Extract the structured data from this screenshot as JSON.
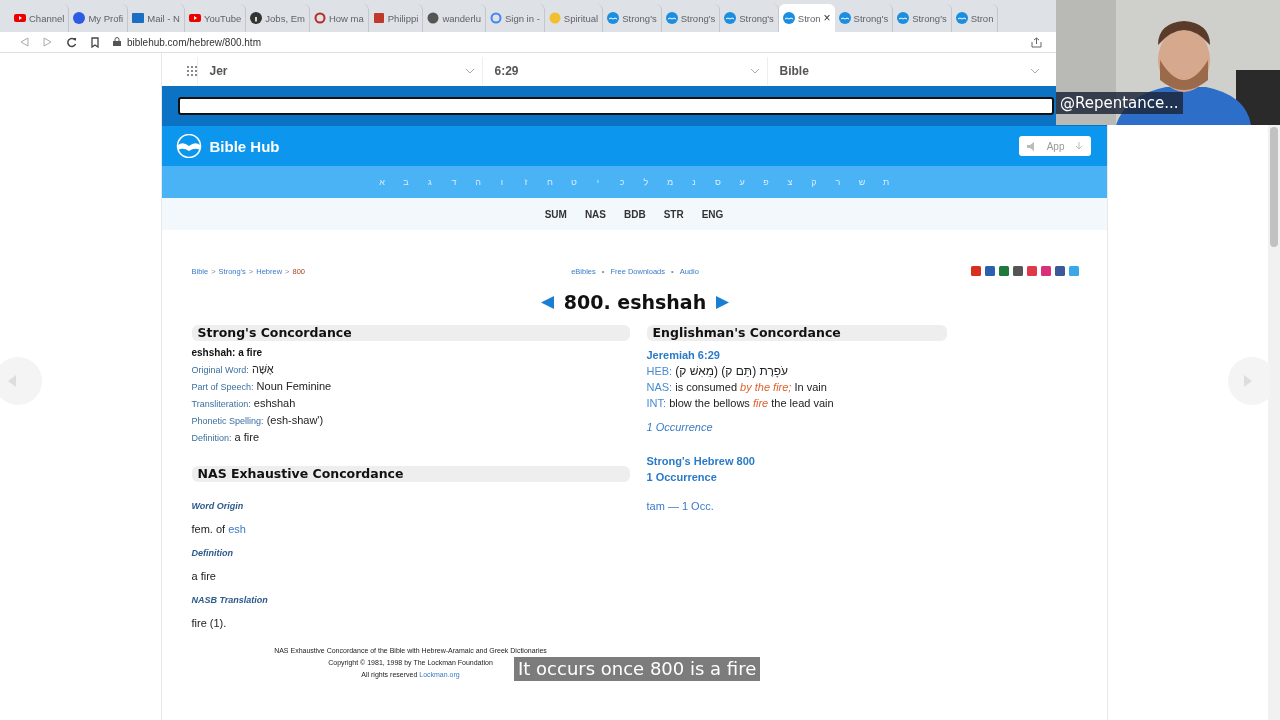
{
  "browser": {
    "tabs": [
      {
        "label": "Channel",
        "kind": "youtube",
        "selected": false
      },
      {
        "label": "My Profi",
        "kind": "circle",
        "selected": false
      },
      {
        "label": "Mail - N",
        "kind": "mail",
        "selected": false
      },
      {
        "label": "YouTube",
        "kind": "youtube",
        "selected": false
      },
      {
        "label": "Jobs, Em",
        "kind": "info",
        "selected": false
      },
      {
        "label": "How ma",
        "kind": "ring",
        "selected": false
      },
      {
        "label": "Philippi",
        "kind": "book",
        "selected": false
      },
      {
        "label": "wanderlu",
        "kind": "globe",
        "selected": false
      },
      {
        "label": "Sign in -",
        "kind": "google",
        "selected": false
      },
      {
        "label": "Spiritual",
        "kind": "smiley",
        "selected": false
      },
      {
        "label": "Strong's",
        "kind": "biblehub",
        "selected": false
      },
      {
        "label": "Strong's",
        "kind": "biblehub",
        "selected": false
      },
      {
        "label": "Strong's",
        "kind": "biblehub",
        "selected": false
      },
      {
        "label": "Stron",
        "kind": "biblehub",
        "selected": true
      },
      {
        "label": "Strong's",
        "kind": "biblehub",
        "selected": false
      },
      {
        "label": "Strong's",
        "kind": "biblehub",
        "selected": false
      },
      {
        "label": "Stron",
        "kind": "biblehub",
        "selected": false
      }
    ],
    "close": "×",
    "url": "biblehub.com/hebrew/800.htm"
  },
  "site": {
    "selectors": [
      "Jer",
      "6:29",
      "Bible"
    ],
    "logo": "Bible Hub",
    "app_button": "App",
    "hebrew_letters": [
      "ת",
      "ש",
      "ר",
      "ק",
      "צ",
      "פ",
      "ע",
      "ס",
      "נ",
      "מ",
      "ל",
      "כ",
      "י",
      "ט",
      "ח",
      "ז",
      "ו",
      "ה",
      "ד",
      "ג",
      "ב",
      "א"
    ],
    "nav_tabs": [
      "SUM",
      "NAS",
      "BDB",
      "STR",
      "ENG"
    ],
    "breadcrumb": {
      "separator": ">",
      "items": [
        "Bible",
        "Strong's",
        "Hebrew",
        "800"
      ]
    },
    "top_links": {
      "separator": "•",
      "items": [
        "eBibles",
        "Free Downloads",
        "Audio"
      ]
    },
    "title": "800. eshshah",
    "strongs": {
      "heading": "Strong's Concordance",
      "headword": "eshshah: a fire",
      "fields": [
        {
          "label": "Original Word:",
          "value": "אֶשָּׁה"
        },
        {
          "label": "Part of Speech:",
          "value": "Noun Feminine"
        },
        {
          "label": "Transliteration:",
          "value": "eshshah"
        },
        {
          "label": "Phonetic Spelling:",
          "value": "(esh-shaw')"
        },
        {
          "label": "Definition:",
          "value": "a fire"
        }
      ]
    },
    "nas": {
      "heading": "NAS Exhaustive Concordance",
      "sections": [
        {
          "label": "Word Origin",
          "text": "fem. of",
          "link": "esh"
        },
        {
          "label": "Definition",
          "text": "a fire"
        },
        {
          "label": "NASB Translation",
          "text": "fire (1)."
        }
      ],
      "footer": [
        "NAS Exhaustive Concordance of the Bible with Hebrew-Aramaic and Greek Dictionaries",
        "Copyright © 1981, 1998 by The Lockman Foundation"
      ],
      "rights": "All rights reserved",
      "rights_link": "Lockman.org"
    },
    "englishman": {
      "heading": "Englishman's Concordance",
      "reference": "Jeremiah 6:29",
      "lines": [
        {
          "label": "HEB:",
          "text": "עֹפָרֶת (תַּם ק) (מֵאִשׁ ק)",
          "kind": "hebrew"
        },
        {
          "label": "NAS:",
          "text": "is consumed *by the fire;* In vain",
          "kind": "english"
        },
        {
          "label": "INT:",
          "text": "blow the bellows *fire* the lead vain",
          "kind": "english"
        }
      ],
      "occurrence": "1 Occurrence",
      "strongs_link": "Strong's Hebrew 800",
      "strongs_count": "1 Occurrence",
      "word_count": "tam — 1 Occ."
    }
  },
  "webcam": {
    "name": "@Repentance..."
  },
  "caption": "It occurs once 800 is a fire"
}
